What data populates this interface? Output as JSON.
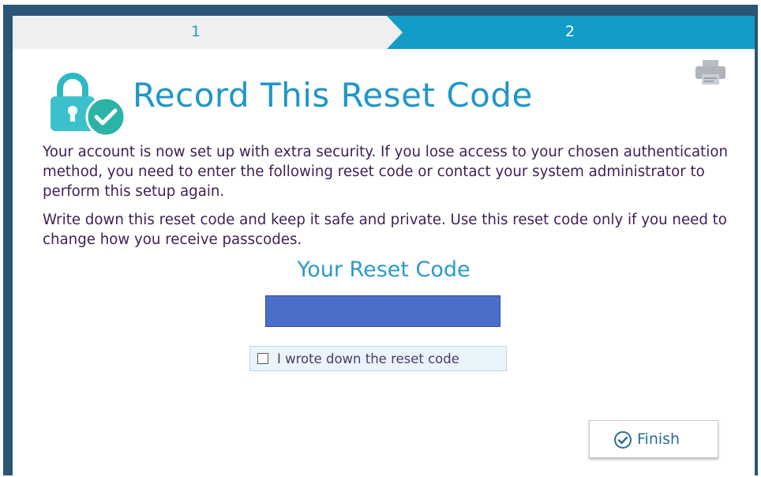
{
  "stepper": {
    "steps": [
      {
        "label": "1",
        "state": "completed"
      },
      {
        "label": "2",
        "state": "current"
      }
    ]
  },
  "header": {
    "title": "Record This Reset Code",
    "print_icon": "printer-icon",
    "lock_icon": "lock-check-icon"
  },
  "body": {
    "paragraph1": "Your account is now set up with extra security. If you lose access to your chosen authentication method, you need to enter the following reset code or contact your system administrator to perform this setup again.",
    "paragraph2": "Write down this reset code and keep it safe and private. Use this reset code only if you need to change how you receive passcodes."
  },
  "reset_code": {
    "heading": "Your Reset Code",
    "value_redacted": true
  },
  "confirm": {
    "label": "I wrote down the reset code",
    "checked": false
  },
  "footer": {
    "finish_label": "Finish"
  },
  "colors": {
    "accent": "#1e97c7",
    "active_step": "#129cc8",
    "inactive_step": "#efefef",
    "body_text": "#3e1f55",
    "redaction": "#4a6fcb"
  }
}
